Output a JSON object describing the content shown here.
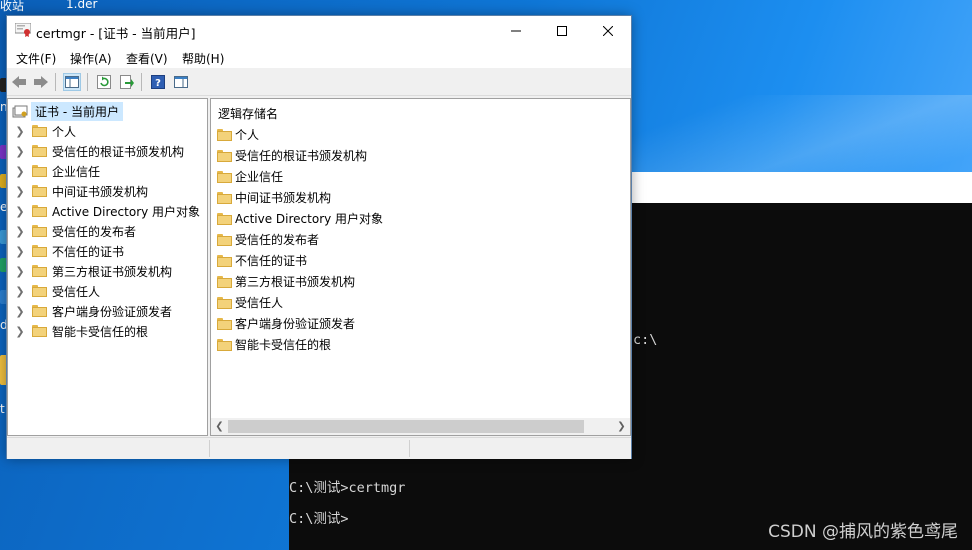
{
  "desktop": {
    "labels": [
      "收站",
      "1.der"
    ],
    "left_edge_chars": [
      "n",
      "e",
      "d",
      "t"
    ]
  },
  "console": {
    "lines": [
      "C:\\测试>certmgr",
      "C:\\测试>"
    ],
    "fragments": [
      "c:\\",
      "← ←",
      "←←← ←←← ←← ←←"
    ],
    "watermark": "CSDN @捕风的紫色鸢尾"
  },
  "window": {
    "title": "certmgr - [证书 - 当前用户]",
    "menu": [
      "文件(F)",
      "操作(A)",
      "查看(V)",
      "帮助(H)"
    ],
    "tree_root": "证书 - 当前用户",
    "tree_items": [
      "个人",
      "受信任的根证书颁发机构",
      "企业信任",
      "中间证书颁发机构",
      "Active Directory 用户对象",
      "受信任的发布者",
      "不信任的证书",
      "第三方根证书颁发机构",
      "受信任人",
      "客户端身份验证颁发者",
      "智能卡受信任的根"
    ],
    "list_header": "逻辑存储名",
    "list_items": [
      "个人",
      "受信任的根证书颁发机构",
      "企业信任",
      "中间证书颁发机构",
      "Active Directory 用户对象",
      "受信任的发布者",
      "不信任的证书",
      "第三方根证书颁发机构",
      "受信任人",
      "客户端身份验证颁发者",
      "智能卡受信任的根"
    ]
  }
}
